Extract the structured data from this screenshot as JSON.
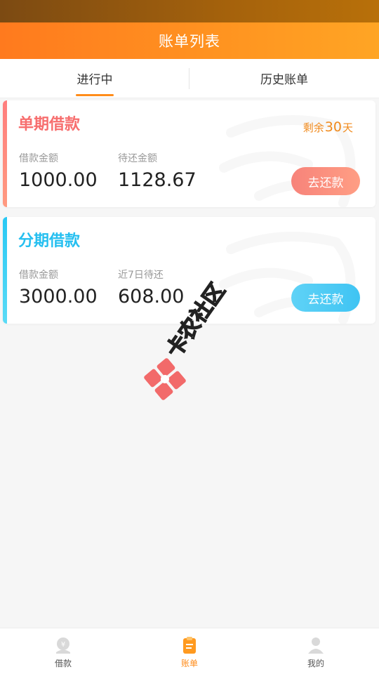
{
  "header": {
    "title": "账单列表"
  },
  "tabs": [
    {
      "label": "进行中",
      "active": true
    },
    {
      "label": "历史账单",
      "active": false
    }
  ],
  "loans": [
    {
      "title": "单期借款",
      "remaining_prefix": "剩余",
      "remaining_days": "30",
      "remaining_suffix": "天",
      "label_1": "借款金额",
      "value_1": "1000.00",
      "label_2": "待还金额",
      "value_2": "1128.67",
      "button": "去还款",
      "accent_color": "#f76e6e"
    },
    {
      "title": "分期借款",
      "label_1": "借款金额",
      "value_1": "3000.00",
      "label_2": "近7日待还",
      "value_2": "608.00",
      "button": "去还款",
      "accent_color": "#25bff0"
    }
  ],
  "watermark": {
    "text": "卡农社区"
  },
  "bottom_nav": [
    {
      "label": "借款",
      "icon": "money-bag-icon",
      "active": false
    },
    {
      "label": "账单",
      "icon": "bill-clipboard-icon",
      "active": true
    },
    {
      "label": "我的",
      "icon": "user-icon",
      "active": false
    }
  ],
  "colors": {
    "primary": "#ff8c1a",
    "title_bar": "#ff9220"
  }
}
